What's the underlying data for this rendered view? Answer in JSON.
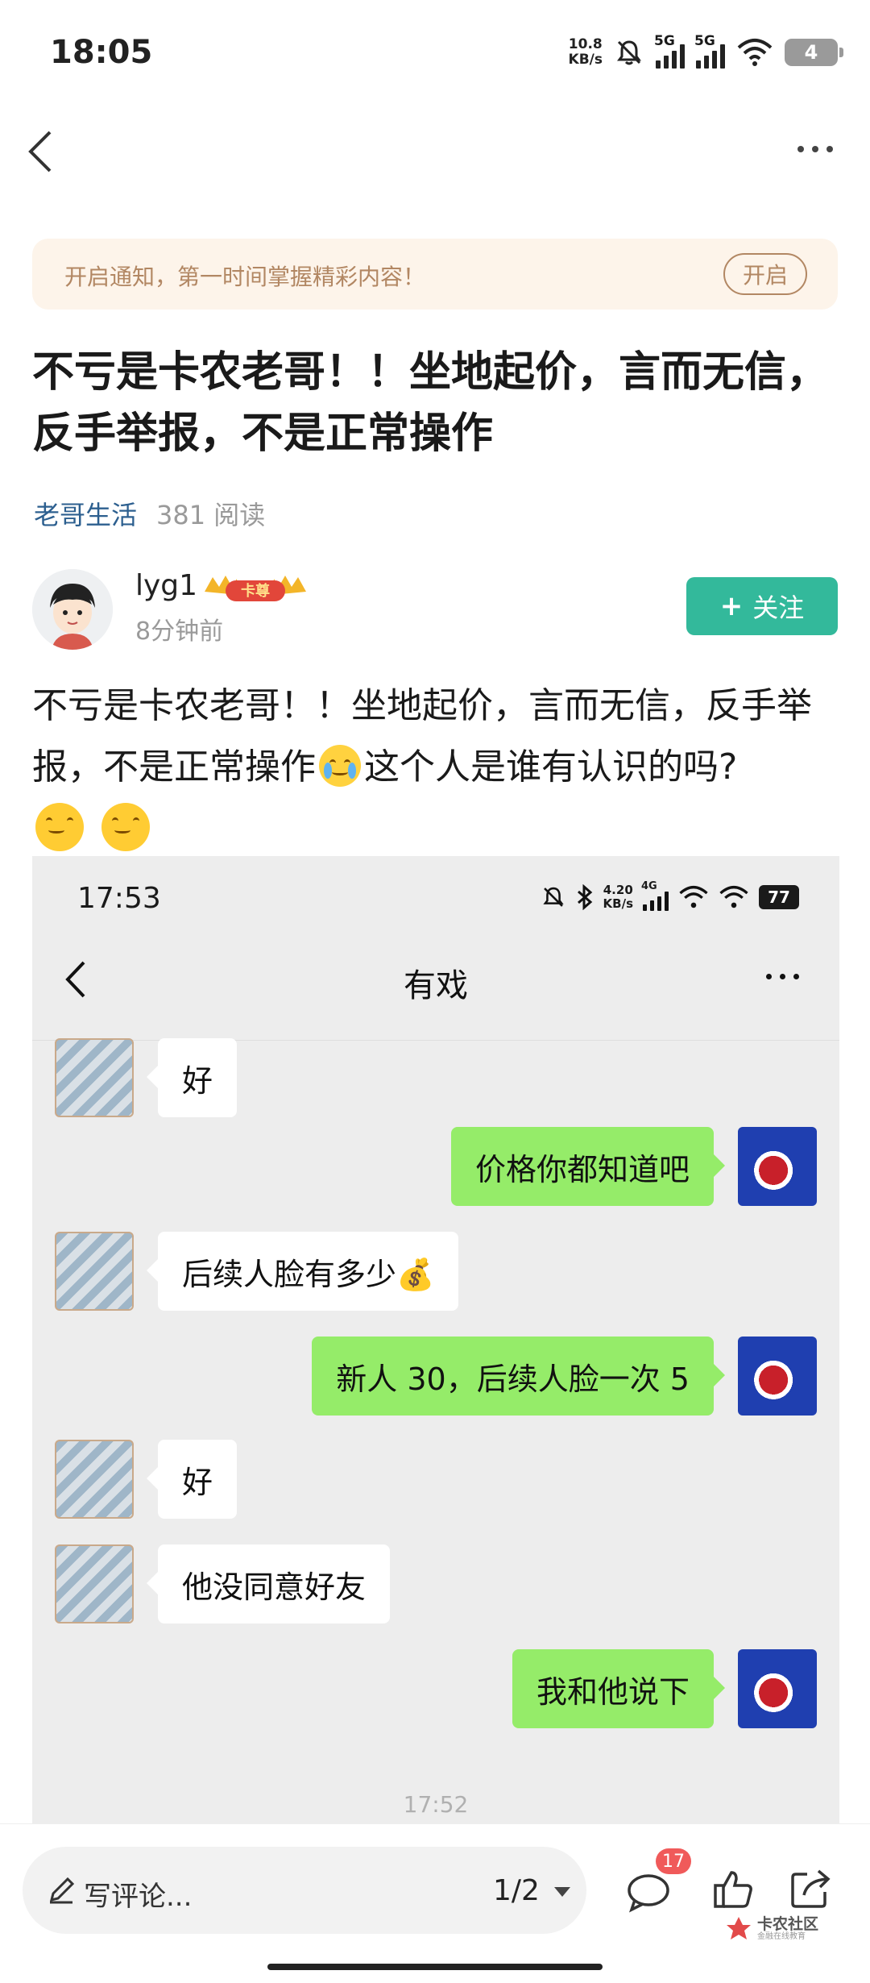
{
  "status_bar": {
    "time": "18:05",
    "net_speed_value": "10.8",
    "net_speed_unit": "KB/s",
    "sim1": "5G",
    "sim2": "5G",
    "battery": "4"
  },
  "nav": {
    "back_icon": "chevron-left-icon",
    "more_icon": "more-dots-icon"
  },
  "notify": {
    "text": "开启通知，第一时间掌握精彩内容！",
    "button": "开启"
  },
  "post": {
    "title": "不亏是卡农老哥！！坐地起价，言而无信，反手举报，不是正常操作",
    "category": "老哥生活",
    "reads": "381 阅读",
    "body_part1": "不亏是卡农老哥！！坐地起价，言而无信，反手举报，不是正常操作",
    "body_part2": "这个人是谁有认识的吗?"
  },
  "author": {
    "name": "lyg1",
    "badge": "卡尊",
    "time": "8分钟前",
    "follow_label": "关注"
  },
  "screenshot": {
    "status_time": "17:53",
    "net_speed_value": "4.20",
    "net_speed_unit": "KB/s",
    "net_type": "4G",
    "battery": "77",
    "chat_title": "有戏",
    "messages": [
      {
        "side": "them",
        "text": "好"
      },
      {
        "side": "me",
        "text": "价格你都知道吧"
      },
      {
        "side": "them",
        "text": "后续人脸有多少💰"
      },
      {
        "side": "me",
        "text": "新人 30，后续人脸一次 5"
      },
      {
        "side": "them",
        "text": "好"
      },
      {
        "side": "them",
        "text": "他没同意好友"
      },
      {
        "side": "me",
        "text": "我和他说下"
      }
    ],
    "timestamp": "17:52"
  },
  "bottom_bar": {
    "comment_placeholder": "写评论...",
    "pager": "1/2",
    "comment_count": "17",
    "watermark_main": "卡农社区",
    "watermark_sub": "金融在线教育"
  },
  "colors": {
    "accent_green": "#33b99b",
    "category_blue": "#2c5f8f",
    "banner_bg": "#fdf4ea",
    "banner_text": "#b28763",
    "wechat_green": "#95ec69",
    "badge_red": "#f05a5a"
  }
}
